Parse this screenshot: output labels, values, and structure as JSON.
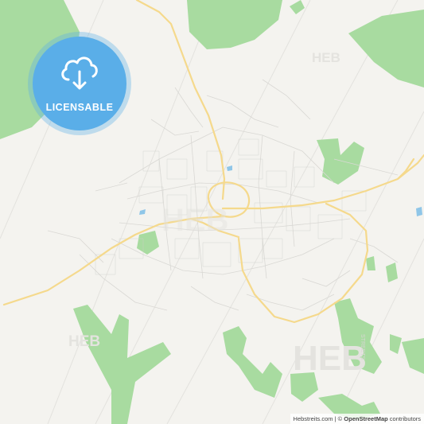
{
  "badge": {
    "label": "LICENSABLE",
    "icon": "cloud-download-icon",
    "color": "#5aaee8"
  },
  "watermark": {
    "text": "HEB",
    "subtext": "STREETS"
  },
  "attribution": {
    "site": "Hebstreits.com",
    "separator": " | © ",
    "osm": "OpenStreetMap",
    "suffix": " contributors"
  },
  "colors": {
    "background": "#f4f3ef",
    "green": "#a8dba0",
    "road_major": "#f5d98c",
    "road_minor": "#ffffff",
    "water": "#8fc6e8"
  }
}
